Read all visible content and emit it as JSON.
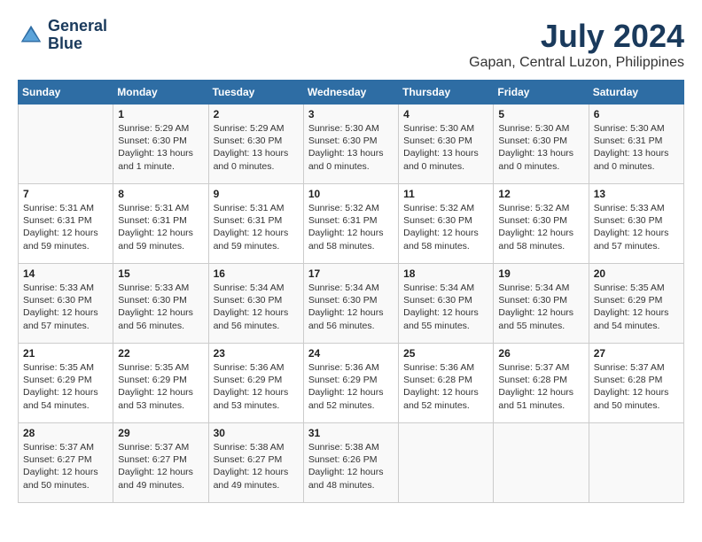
{
  "header": {
    "logo_line1": "General",
    "logo_line2": "Blue",
    "month": "July 2024",
    "location": "Gapan, Central Luzon, Philippines"
  },
  "weekdays": [
    "Sunday",
    "Monday",
    "Tuesday",
    "Wednesday",
    "Thursday",
    "Friday",
    "Saturday"
  ],
  "weeks": [
    [
      {
        "day": "",
        "info": ""
      },
      {
        "day": "1",
        "info": "Sunrise: 5:29 AM\nSunset: 6:30 PM\nDaylight: 13 hours\nand 1 minute."
      },
      {
        "day": "2",
        "info": "Sunrise: 5:29 AM\nSunset: 6:30 PM\nDaylight: 13 hours\nand 0 minutes."
      },
      {
        "day": "3",
        "info": "Sunrise: 5:30 AM\nSunset: 6:30 PM\nDaylight: 13 hours\nand 0 minutes."
      },
      {
        "day": "4",
        "info": "Sunrise: 5:30 AM\nSunset: 6:30 PM\nDaylight: 13 hours\nand 0 minutes."
      },
      {
        "day": "5",
        "info": "Sunrise: 5:30 AM\nSunset: 6:30 PM\nDaylight: 13 hours\nand 0 minutes."
      },
      {
        "day": "6",
        "info": "Sunrise: 5:30 AM\nSunset: 6:31 PM\nDaylight: 13 hours\nand 0 minutes."
      }
    ],
    [
      {
        "day": "7",
        "info": "Sunrise: 5:31 AM\nSunset: 6:31 PM\nDaylight: 12 hours\nand 59 minutes."
      },
      {
        "day": "8",
        "info": "Sunrise: 5:31 AM\nSunset: 6:31 PM\nDaylight: 12 hours\nand 59 minutes."
      },
      {
        "day": "9",
        "info": "Sunrise: 5:31 AM\nSunset: 6:31 PM\nDaylight: 12 hours\nand 59 minutes."
      },
      {
        "day": "10",
        "info": "Sunrise: 5:32 AM\nSunset: 6:31 PM\nDaylight: 12 hours\nand 58 minutes."
      },
      {
        "day": "11",
        "info": "Sunrise: 5:32 AM\nSunset: 6:30 PM\nDaylight: 12 hours\nand 58 minutes."
      },
      {
        "day": "12",
        "info": "Sunrise: 5:32 AM\nSunset: 6:30 PM\nDaylight: 12 hours\nand 58 minutes."
      },
      {
        "day": "13",
        "info": "Sunrise: 5:33 AM\nSunset: 6:30 PM\nDaylight: 12 hours\nand 57 minutes."
      }
    ],
    [
      {
        "day": "14",
        "info": "Sunrise: 5:33 AM\nSunset: 6:30 PM\nDaylight: 12 hours\nand 57 minutes."
      },
      {
        "day": "15",
        "info": "Sunrise: 5:33 AM\nSunset: 6:30 PM\nDaylight: 12 hours\nand 56 minutes."
      },
      {
        "day": "16",
        "info": "Sunrise: 5:34 AM\nSunset: 6:30 PM\nDaylight: 12 hours\nand 56 minutes."
      },
      {
        "day": "17",
        "info": "Sunrise: 5:34 AM\nSunset: 6:30 PM\nDaylight: 12 hours\nand 56 minutes."
      },
      {
        "day": "18",
        "info": "Sunrise: 5:34 AM\nSunset: 6:30 PM\nDaylight: 12 hours\nand 55 minutes."
      },
      {
        "day": "19",
        "info": "Sunrise: 5:34 AM\nSunset: 6:30 PM\nDaylight: 12 hours\nand 55 minutes."
      },
      {
        "day": "20",
        "info": "Sunrise: 5:35 AM\nSunset: 6:29 PM\nDaylight: 12 hours\nand 54 minutes."
      }
    ],
    [
      {
        "day": "21",
        "info": "Sunrise: 5:35 AM\nSunset: 6:29 PM\nDaylight: 12 hours\nand 54 minutes."
      },
      {
        "day": "22",
        "info": "Sunrise: 5:35 AM\nSunset: 6:29 PM\nDaylight: 12 hours\nand 53 minutes."
      },
      {
        "day": "23",
        "info": "Sunrise: 5:36 AM\nSunset: 6:29 PM\nDaylight: 12 hours\nand 53 minutes."
      },
      {
        "day": "24",
        "info": "Sunrise: 5:36 AM\nSunset: 6:29 PM\nDaylight: 12 hours\nand 52 minutes."
      },
      {
        "day": "25",
        "info": "Sunrise: 5:36 AM\nSunset: 6:28 PM\nDaylight: 12 hours\nand 52 minutes."
      },
      {
        "day": "26",
        "info": "Sunrise: 5:37 AM\nSunset: 6:28 PM\nDaylight: 12 hours\nand 51 minutes."
      },
      {
        "day": "27",
        "info": "Sunrise: 5:37 AM\nSunset: 6:28 PM\nDaylight: 12 hours\nand 50 minutes."
      }
    ],
    [
      {
        "day": "28",
        "info": "Sunrise: 5:37 AM\nSunset: 6:27 PM\nDaylight: 12 hours\nand 50 minutes."
      },
      {
        "day": "29",
        "info": "Sunrise: 5:37 AM\nSunset: 6:27 PM\nDaylight: 12 hours\nand 49 minutes."
      },
      {
        "day": "30",
        "info": "Sunrise: 5:38 AM\nSunset: 6:27 PM\nDaylight: 12 hours\nand 49 minutes."
      },
      {
        "day": "31",
        "info": "Sunrise: 5:38 AM\nSunset: 6:26 PM\nDaylight: 12 hours\nand 48 minutes."
      },
      {
        "day": "",
        "info": ""
      },
      {
        "day": "",
        "info": ""
      },
      {
        "day": "",
        "info": ""
      }
    ]
  ]
}
